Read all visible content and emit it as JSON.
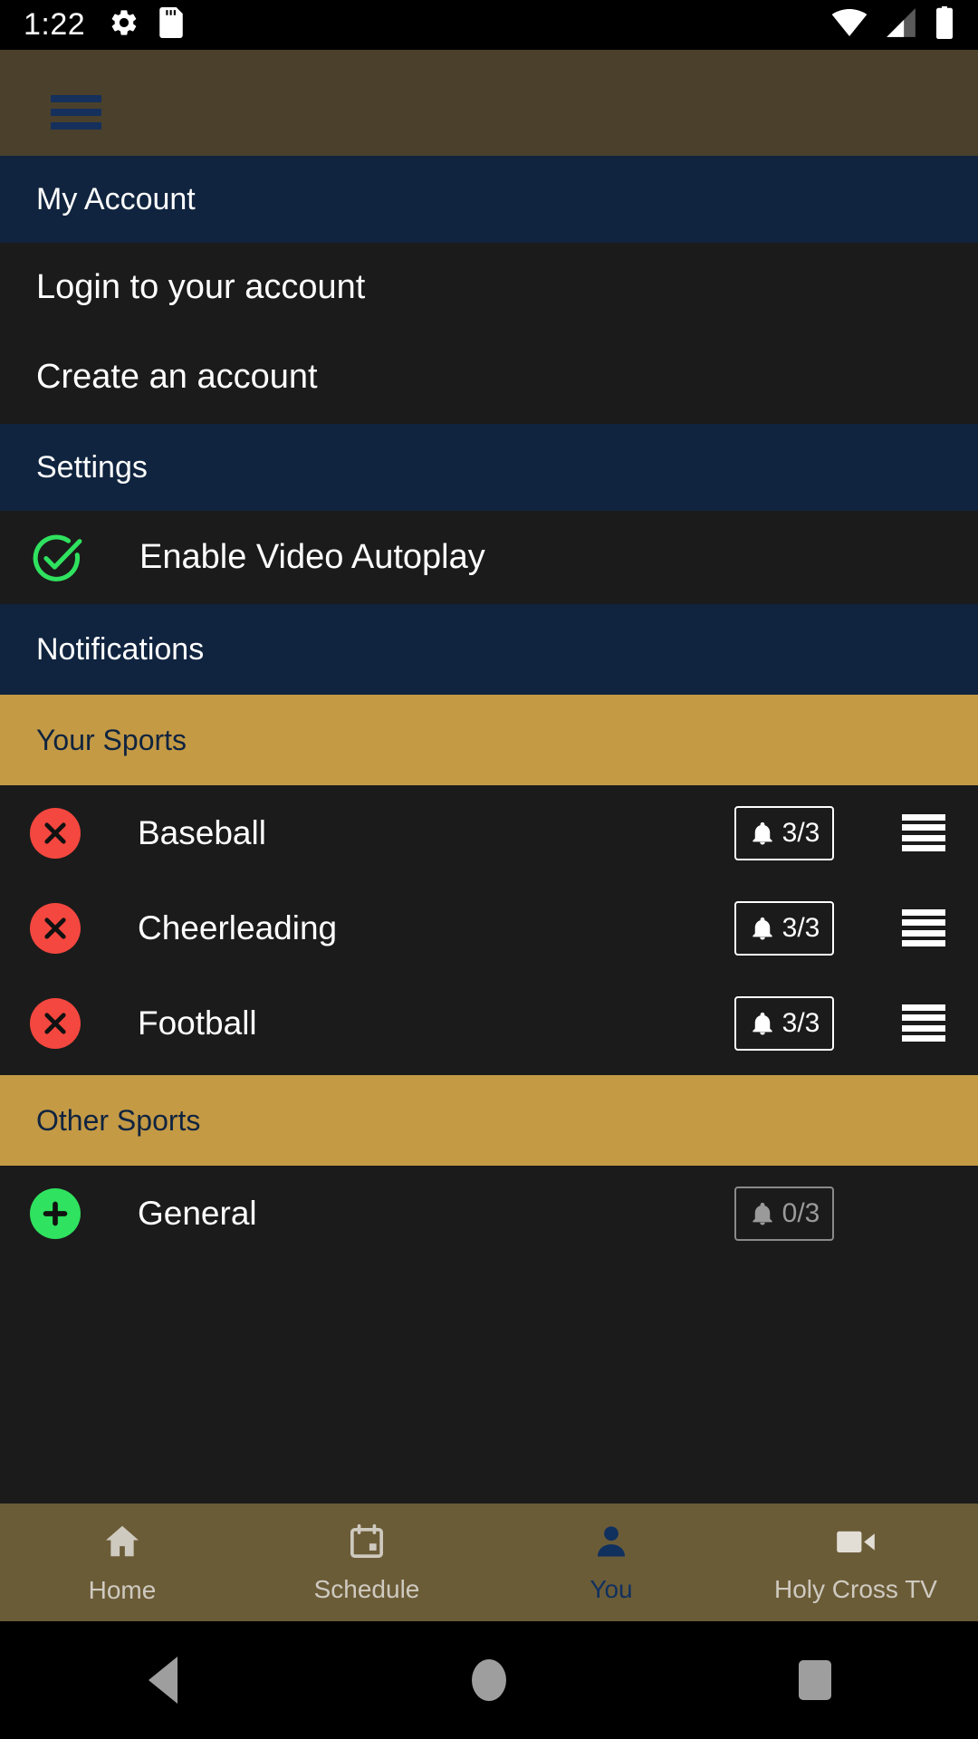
{
  "status_bar": {
    "time": "1:22",
    "left_icons": [
      "settings-gear-icon",
      "sd-card-icon"
    ],
    "right_icons": [
      "wifi-icon",
      "cell-signal-icon",
      "battery-icon"
    ]
  },
  "top_bar": {
    "menu_icon": "hamburger-menu-icon",
    "background_color": "#4a402c",
    "icon_color": "#15305c"
  },
  "sections": {
    "my_account": {
      "header": "My Account",
      "items": [
        {
          "label": "Login to your account"
        },
        {
          "label": "Create an account"
        }
      ]
    },
    "settings": {
      "header": "Settings",
      "autoplay": {
        "label": "Enable Video Autoplay",
        "checked": true,
        "icon": "check-circle-icon",
        "color": "#2fe25f"
      }
    },
    "notifications": {
      "header": "Notifications",
      "your_sports": {
        "header": "Your Sports",
        "rows": [
          {
            "name": "Baseball",
            "action": "remove",
            "action_icon": "circle-x-icon",
            "count": "3/3",
            "bell_icon": "bell-icon",
            "enabled": true,
            "handle": "drag-handle-icon"
          },
          {
            "name": "Cheerleading",
            "action": "remove",
            "action_icon": "circle-x-icon",
            "count": "3/3",
            "bell_icon": "bell-icon",
            "enabled": true,
            "handle": "drag-handle-icon"
          },
          {
            "name": "Football",
            "action": "remove",
            "action_icon": "circle-x-icon",
            "count": "3/3",
            "bell_icon": "bell-icon",
            "enabled": true,
            "handle": "drag-handle-icon"
          }
        ]
      },
      "other_sports": {
        "header": "Other Sports",
        "rows": [
          {
            "name": "General",
            "action": "add",
            "action_icon": "circle-plus-icon",
            "count": "0/3",
            "bell_icon": "bell-icon",
            "enabled": false
          }
        ]
      }
    }
  },
  "bottom_nav": {
    "active": "You",
    "tabs": [
      {
        "label": "Home",
        "icon": "home-icon",
        "active": false
      },
      {
        "label": "Schedule",
        "icon": "calendar-icon",
        "active": false
      },
      {
        "label": "You",
        "icon": "person-icon",
        "active": true
      },
      {
        "label": "Holy Cross TV",
        "icon": "video-camera-icon",
        "active": false
      }
    ],
    "background_color": "#6b5c38",
    "active_color": "#10305e",
    "inactive_color": "#cfcac0"
  },
  "android_nav": {
    "buttons": [
      {
        "name": "back-button",
        "icon": "triangle-left-icon"
      },
      {
        "name": "home-button",
        "icon": "circle-icon"
      },
      {
        "name": "recents-button",
        "icon": "square-icon"
      }
    ]
  },
  "colors": {
    "navy_header": "#10243f",
    "gold_header": "#c49a45",
    "row_bg": "#1b1b1b",
    "remove_red": "#f4473f",
    "add_green": "#2fe25f"
  }
}
